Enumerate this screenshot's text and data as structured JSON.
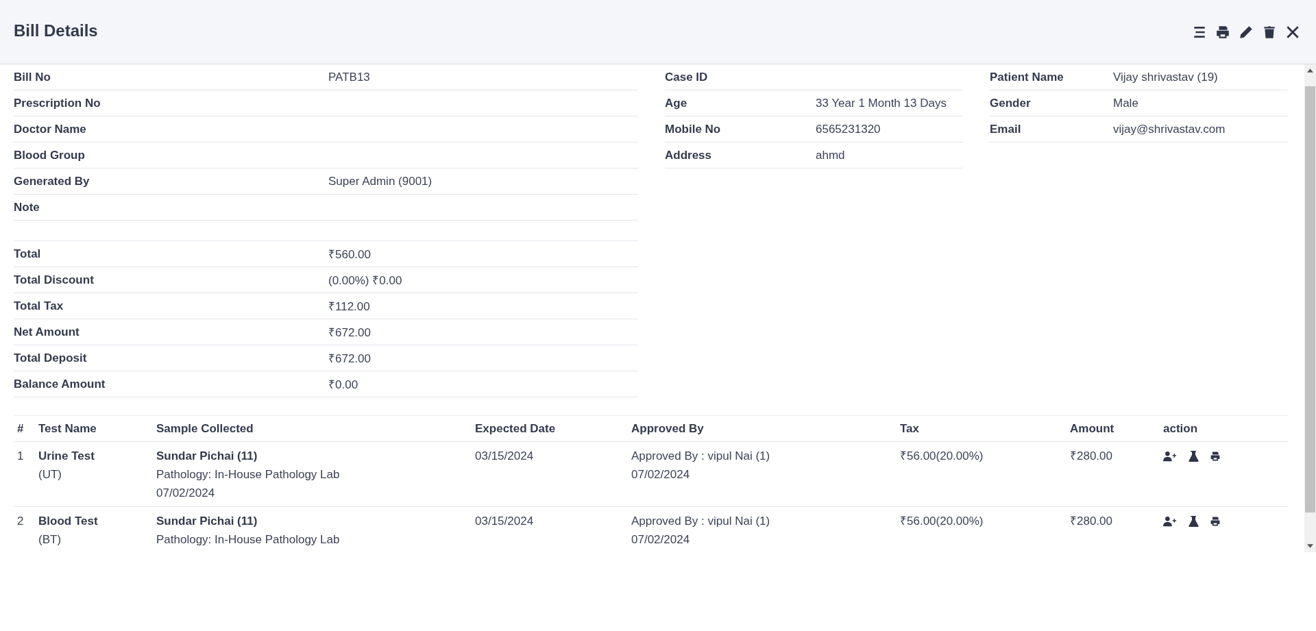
{
  "window": {
    "title": "Bill Details"
  },
  "bill_info": [
    {
      "label": "Bill No",
      "value": "PATB13"
    },
    {
      "label": "Prescription No"
    },
    {
      "label": "Doctor Name"
    },
    {
      "label": "Blood Group"
    },
    {
      "label": "Generated By",
      "value": "Super Admin (9001)"
    },
    {
      "label": "Note"
    }
  ],
  "totals": [
    {
      "label": "Total",
      "value": "₹560.00"
    },
    {
      "label": "Total Discount",
      "value": "(0.00%) ₹0.00"
    },
    {
      "label": "Total Tax",
      "value": "₹112.00"
    },
    {
      "label": "Net Amount",
      "value": "₹672.00"
    },
    {
      "label": "Total Deposit",
      "value": "₹672.00"
    },
    {
      "label": "Balance Amount",
      "value": "₹0.00"
    }
  ],
  "case_info": [
    {
      "label": "Case ID"
    },
    {
      "label": "Age",
      "value": "33 Year 1 Month 13 Days"
    },
    {
      "label": "Mobile No",
      "value": "6565231320"
    },
    {
      "label": "Address",
      "value": "ahmd"
    }
  ],
  "patient_info": [
    {
      "label": "Patient Name",
      "value": "Vijay shrivastav (19)"
    },
    {
      "label": "Gender",
      "value": "Male"
    },
    {
      "label": "Email",
      "value": "vijay@shrivastav.com"
    }
  ],
  "table": {
    "columns": [
      "#",
      "Test Name",
      "Sample Collected",
      "Expected Date",
      "Approved By",
      "Tax",
      "Amount",
      "action"
    ],
    "rows": [
      {
        "number": "1",
        "test_name": "Urine Test",
        "test_code": "(UT)",
        "collector": "Sundar Pichai (11)",
        "lab": "Pathology: In-House Pathology Lab",
        "collected_date": "07/02/2024",
        "expected_date": "03/15/2024",
        "approved_by": "Approved By : vipul Nai (1)",
        "approved_date": "07/02/2024",
        "tax": "₹56.00(20.00%)",
        "amount": "₹280.00"
      },
      {
        "number": "2",
        "test_name": "Blood Test",
        "test_code": "(BT)",
        "collector": "Sundar Pichai (11)",
        "lab": "Pathology: In-House Pathology Lab",
        "expected_date": "03/15/2024",
        "approved_by": "Approved By : vipul Nai (1)",
        "approved_date": "07/02/2024",
        "tax": "₹56.00(20.00%)",
        "amount": "₹280.00"
      }
    ]
  }
}
